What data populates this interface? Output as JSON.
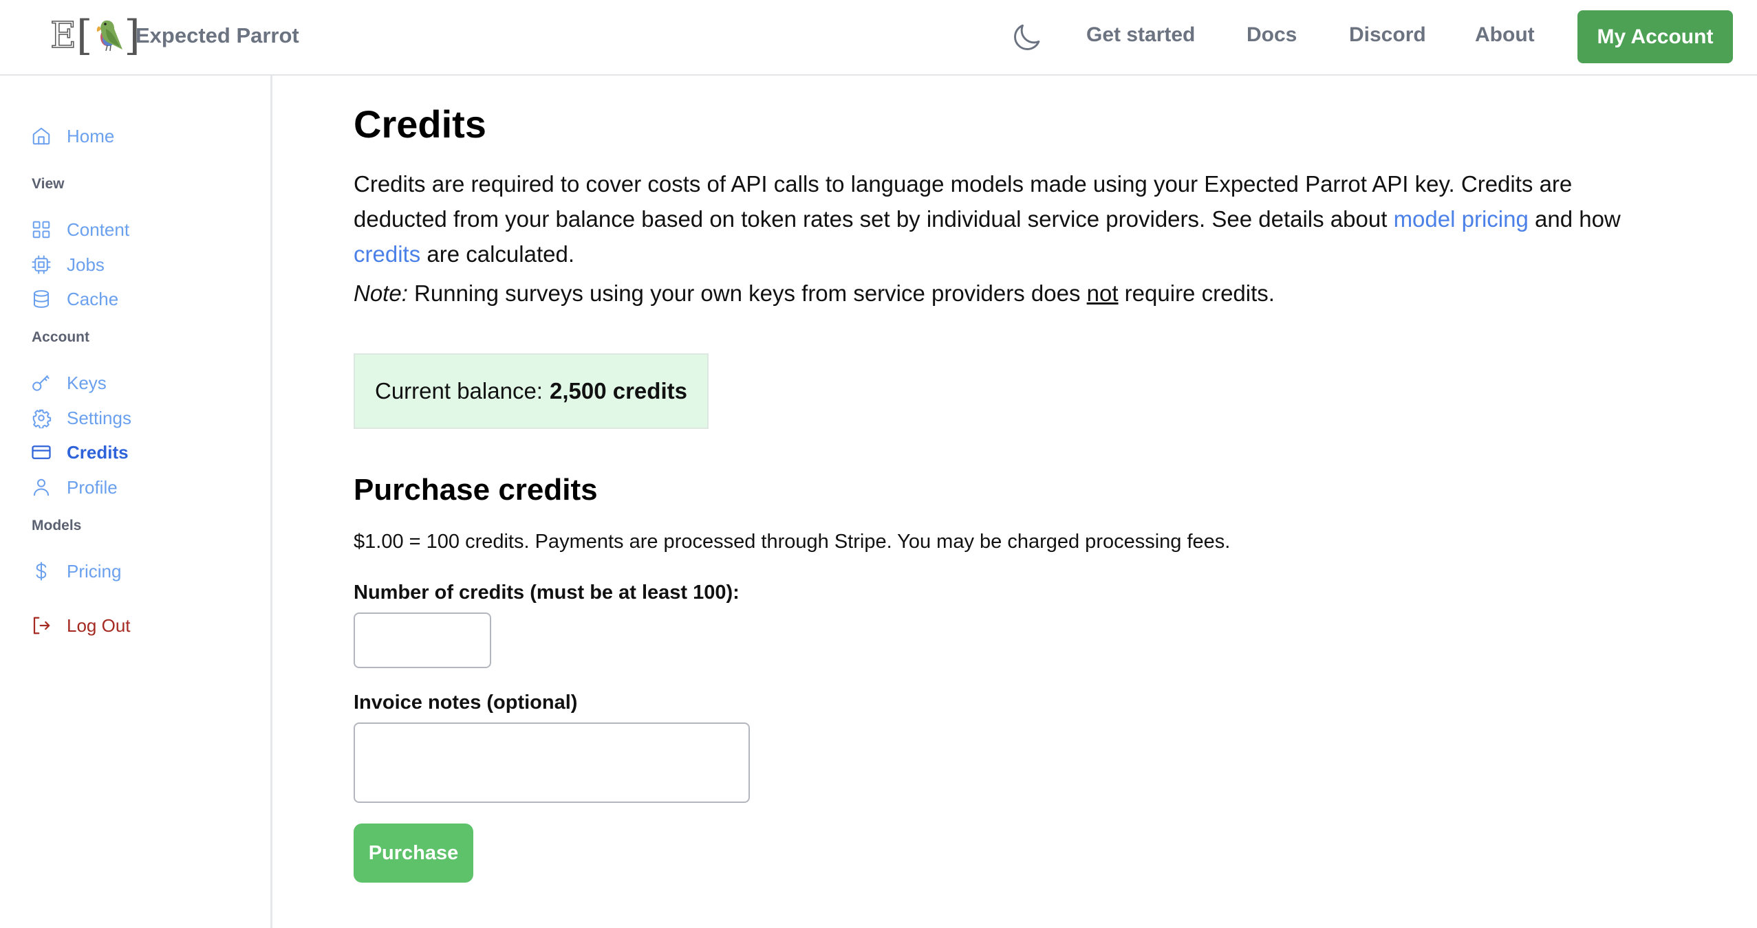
{
  "header": {
    "brand_name": "Expected Parrot",
    "logo_letter": "E",
    "theme_toggle_icon": "moon-icon",
    "nav": [
      {
        "label": "Get started"
      },
      {
        "label": "Docs"
      },
      {
        "label": "Discord"
      },
      {
        "label": "About"
      }
    ],
    "account_button": "My Account",
    "accent_color": "#4ca154"
  },
  "sidebar": {
    "home": {
      "label": "Home",
      "icon": "home-icon"
    },
    "sections": [
      {
        "title": "View",
        "items": [
          {
            "label": "Content",
            "icon": "grid-icon"
          },
          {
            "label": "Jobs",
            "icon": "cpu-chip-icon"
          },
          {
            "label": "Cache",
            "icon": "database-icon"
          }
        ]
      },
      {
        "title": "Account",
        "items": [
          {
            "label": "Keys",
            "icon": "key-icon"
          },
          {
            "label": "Settings",
            "icon": "gear-icon"
          },
          {
            "label": "Credits",
            "icon": "credit-card-icon",
            "active": true
          },
          {
            "label": "Profile",
            "icon": "user-icon"
          }
        ]
      },
      {
        "title": "Models",
        "items": [
          {
            "label": "Pricing",
            "icon": "dollar-icon"
          }
        ]
      }
    ],
    "logout": {
      "label": "Log Out",
      "icon": "logout-icon"
    },
    "link_color": "#6aa0ee",
    "active_color": "#2f63d9",
    "logout_color": "#a52a22"
  },
  "main": {
    "title": "Credits",
    "intro": {
      "text_before": "Credits are required to cover costs of API calls to language models made using your Expected Parrot API key. Credits are deducted from your balance based on token rates set by individual service providers. See details about ",
      "link1": "model pricing",
      "text_middle": " and how ",
      "link2": "credits",
      "text_after": " are calculated."
    },
    "note": {
      "label": "Note:",
      "text_before": " Running surveys using your own keys from service providers does ",
      "emphasis": "not",
      "text_after": " require credits."
    },
    "balance": {
      "label": "Current balance:",
      "value": "2,500 credits"
    },
    "purchase": {
      "heading": "Purchase credits",
      "price_info": "$1.00 = 100 credits. Payments are processed through Stripe. You may be charged processing fees.",
      "credits_label": "Number of credits (must be at least 100):",
      "credits_value": "",
      "notes_label": "Invoice notes (optional)",
      "notes_value": "",
      "button": "Purchase"
    }
  }
}
